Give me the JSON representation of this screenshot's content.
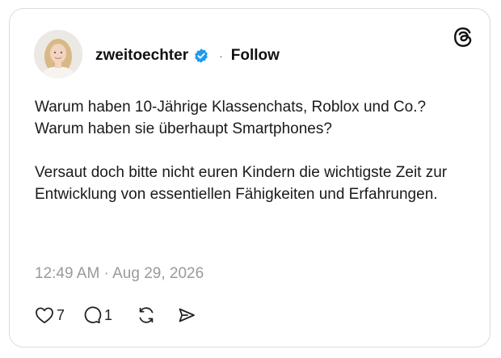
{
  "post": {
    "author": {
      "username": "zweitoechter",
      "verified": true,
      "avatar_icon": "profile-photo",
      "separator": "·",
      "follow_label": "Follow"
    },
    "brand_icon": "threads-logo-icon",
    "text_paragraphs": [
      "Warum haben 10-Jährige Klassenchats, Roblox und Co.? Warum haben sie überhaupt Smartphones?",
      "Versaut doch bitte nicht euren Kindern die wichtigste Zeit zur Entwicklung von essentiellen Fähigkeiten und Erfahrungen."
    ],
    "timestamp": "12:49 AM · Aug 29, 2026",
    "actions": {
      "like_count": "7",
      "reply_count": "1"
    }
  },
  "colors": {
    "verified_badge": "#1d9bf0",
    "timestamp": "#9a9a9a",
    "text": "#1a1a1a",
    "border": "#dcdcdc"
  }
}
